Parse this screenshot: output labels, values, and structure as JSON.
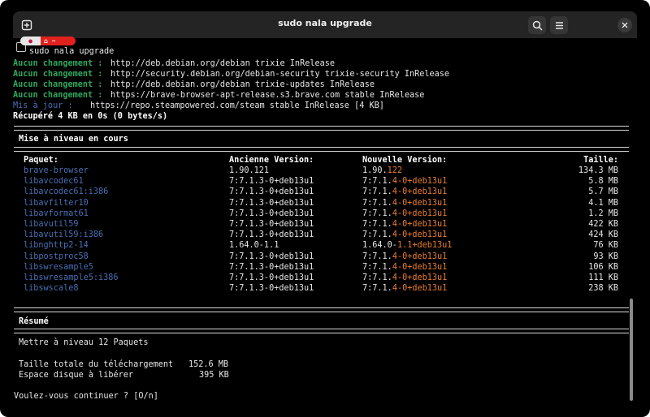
{
  "window": {
    "title": "sudo nala upgrade"
  },
  "prompt": {
    "distro_badge": "●",
    "home_badge": "⌂ ~",
    "command": "sudo nala upgrade"
  },
  "fetch_lines": [
    {
      "label": "Aucun changement :",
      "text": "http://deb.debian.org/debian trixie InRelease"
    },
    {
      "label": "Aucun changement :",
      "text": "http://security.debian.org/debian-security trixie-security InRelease"
    },
    {
      "label": "Aucun changement :",
      "text": "http://deb.debian.org/debian trixie-updates InRelease"
    },
    {
      "label": "Aucun changement :",
      "text": "https://brave-browser-apt-release.s3.brave.com stable InRelease"
    },
    {
      "label": "Mis à jour :",
      "text": "https://repo.steampowered.com/steam stable InRelease [4 KB]"
    }
  ],
  "fetched_summary": "Récupéré 4 KB en 0s (0 bytes/s)",
  "upgrade_section_title": "Mise à niveau en cours",
  "table": {
    "headers": {
      "package": "Paquet:",
      "old": "Ancienne Version:",
      "new": "Nouvelle Version:",
      "size": "Taille:"
    },
    "rows": [
      {
        "package": "brave-browser",
        "old": "1.90.121",
        "new_common": "1.90.",
        "new_changed": "122",
        "size": "134.3 MB"
      },
      {
        "package": "libavcodec61",
        "old": "7:7.1.3-0+deb13u1",
        "new_common": "7:7.1.",
        "new_changed": "4-0+deb13u1",
        "size": "5.8 MB"
      },
      {
        "package": "libavcodec61:i386",
        "old": "7:7.1.3-0+deb13u1",
        "new_common": "7:7.1.",
        "new_changed": "4-0+deb13u1",
        "size": "5.7 MB"
      },
      {
        "package": "libavfilter10",
        "old": "7:7.1.3-0+deb13u1",
        "new_common": "7:7.1.",
        "new_changed": "4-0+deb13u1",
        "size": "4.1 MB"
      },
      {
        "package": "libavformat61",
        "old": "7:7.1.3-0+deb13u1",
        "new_common": "7:7.1.",
        "new_changed": "4-0+deb13u1",
        "size": "1.2 MB"
      },
      {
        "package": "libavutil59",
        "old": "7:7.1.3-0+deb13u1",
        "new_common": "7:7.1.",
        "new_changed": "4-0+deb13u1",
        "size": "422 KB"
      },
      {
        "package": "libavutil59:i386",
        "old": "7:7.1.3-0+deb13u1",
        "new_common": "7:7.1.",
        "new_changed": "4-0+deb13u1",
        "size": "424 KB"
      },
      {
        "package": "libnghttp2-14",
        "old": "1.64.0-1.1",
        "new_common": "1.64.0-",
        "new_changed": "1.1+deb13u1",
        "size": "76 KB"
      },
      {
        "package": "libpostproc58",
        "old": "7:7.1.3-0+deb13u1",
        "new_common": "7:7.1.",
        "new_changed": "4-0+deb13u1",
        "size": "93 KB"
      },
      {
        "package": "libswresample5",
        "old": "7:7.1.3-0+deb13u1",
        "new_common": "7:7.1.",
        "new_changed": "4-0+deb13u1",
        "size": "106 KB"
      },
      {
        "package": "libswresample5:i386",
        "old": "7:7.1.3-0+deb13u1",
        "new_common": "7:7.1.",
        "new_changed": "4-0+deb13u1",
        "size": "111 KB"
      },
      {
        "package": "libswscale8",
        "old": "7:7.1.3-0+deb13u1",
        "new_common": "7:7.1.",
        "new_changed": "4-0+deb13u1",
        "size": "238 KB"
      }
    ]
  },
  "summary": {
    "title": "Résumé",
    "upgrade_line": "Mettre à niveau 12 Paquets",
    "download_label": "Taille totale du téléchargement",
    "download_value": "152.6 MB",
    "disk_label": "Espace disque à libérer",
    "disk_value": "395 KB"
  },
  "confirm_prompt": "Voulez-vous continuer ? [O/n]",
  "colors": {
    "ok_label": "#2fa75f",
    "updated_label": "#4a6fb5",
    "package": "#4a6fb5",
    "version_change": "#e97d2c"
  }
}
